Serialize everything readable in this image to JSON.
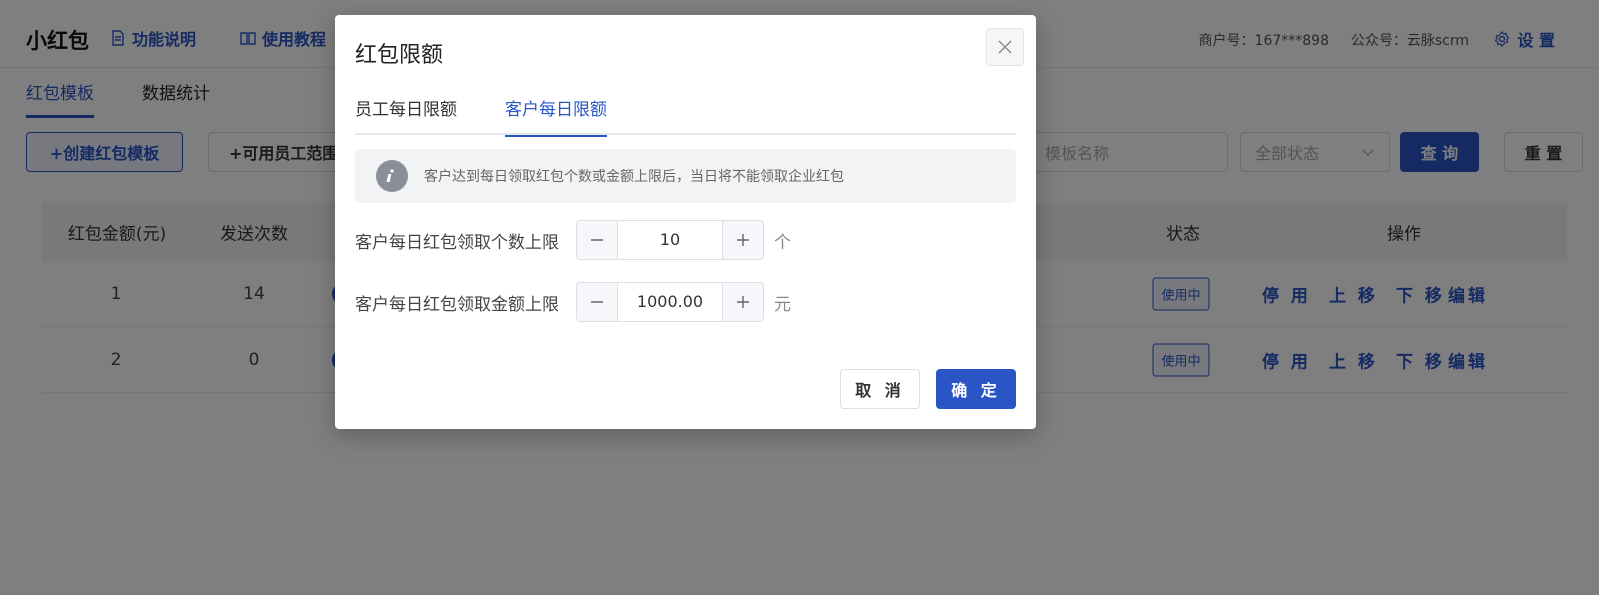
{
  "app": {
    "title": "小红包"
  },
  "nav": {
    "feature_desc": "功能说明",
    "tutorial": "使用教程"
  },
  "header": {
    "merchant": "商户号：167***898",
    "account": "公众号：云脉scrm",
    "settings": "设 置"
  },
  "tabs": [
    {
      "label": "红包模板",
      "active": true
    },
    {
      "label": "数据统计",
      "active": false
    }
  ],
  "toolbar": {
    "create_button": "+创建红包模板",
    "scope_button": "+可用员工范围",
    "name_placeholder": "模板名称",
    "status_placeholder": "全部状态",
    "query_button": "查 询",
    "reset_button": "重 置"
  },
  "table": {
    "headers": {
      "amount": "红包金额(元)",
      "send_count": "发送次数",
      "status": "状态",
      "actions": "操作"
    },
    "rows": [
      {
        "amount": "1",
        "send_count": "14",
        "status": "使用中",
        "disable": "停 用",
        "move_up": "上 移",
        "move_down": "下 移",
        "edit": "编辑"
      },
      {
        "amount": "2",
        "send_count": "0",
        "status": "使用中",
        "disable": "停 用",
        "move_up": "上 移",
        "move_down": "下 移",
        "edit": "编辑"
      }
    ]
  },
  "modal": {
    "title": "红包限额",
    "tabs": [
      {
        "label": "员工每日限额",
        "active": false
      },
      {
        "label": "客户每日限额",
        "active": true
      }
    ],
    "notice": "客户达到每日领取红包个数或金额上限后，当日将不能领取企业红包",
    "fields": {
      "count_limit": {
        "label": "客户每日红包领取个数上限",
        "value": "10",
        "unit": "个"
      },
      "amount_limit": {
        "label": "客户每日红包领取金额上限",
        "value": "1000.00",
        "unit": "元"
      }
    },
    "cancel": "取 消",
    "confirm": "确 定"
  },
  "colors": {
    "accent": "#2a55c7",
    "overlay": "rgba(0,0,0,0.5)"
  }
}
